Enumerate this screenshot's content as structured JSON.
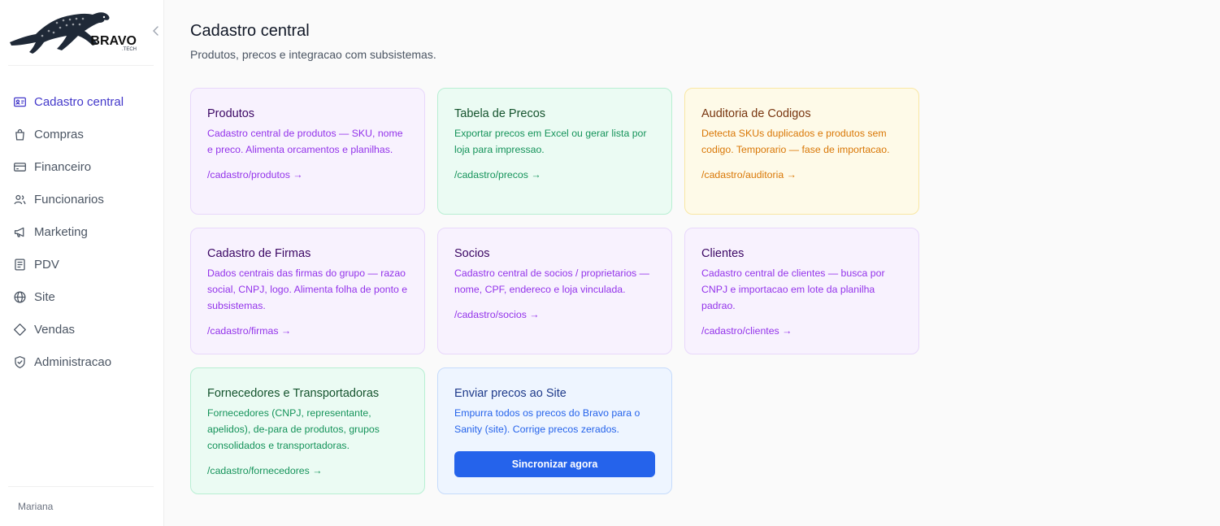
{
  "brand": {
    "name": "BRAVO",
    "suffix": ".TECH"
  },
  "sidebar": {
    "collapse_icon": "chevron-left-icon",
    "items": [
      {
        "label": "Cadastro central",
        "icon": "id-card-icon",
        "active": true
      },
      {
        "label": "Compras",
        "icon": "shopping-bag-icon"
      },
      {
        "label": "Financeiro",
        "icon": "credit-card-icon"
      },
      {
        "label": "Funcionarios",
        "icon": "users-icon"
      },
      {
        "label": "Marketing",
        "icon": "megaphone-icon"
      },
      {
        "label": "PDV",
        "icon": "receipt-icon"
      },
      {
        "label": "Site",
        "icon": "globe-icon"
      },
      {
        "label": "Vendas",
        "icon": "tag-icon"
      },
      {
        "label": "Administracao",
        "icon": "shield-icon"
      }
    ],
    "user": "Mariana"
  },
  "header": {
    "title": "Cadastro central",
    "subtitle": "Produtos, precos e integracao com subsistemas."
  },
  "cards": [
    {
      "title": "Produtos",
      "description": "Cadastro central de produtos — SKU, nome e preco. Alimenta orcamentos e planilhas.",
      "link": "/cadastro/produtos →",
      "color": "purple"
    },
    {
      "title": "Tabela de Precos",
      "description": "Exportar precos em Excel ou gerar lista por loja para impressao.",
      "link": "/cadastro/precos →",
      "color": "green"
    },
    {
      "title": "Auditoria de Codigos",
      "description": "Detecta SKUs duplicados e produtos sem codigo. Temporario — fase de importacao.",
      "link": "/cadastro/auditoria →",
      "color": "yellow"
    },
    {
      "title": "Cadastro de Firmas",
      "description": "Dados centrais das firmas do grupo — razao social, CNPJ, logo. Alimenta folha de ponto e subsistemas.",
      "link": "/cadastro/firmas →",
      "color": "purple"
    },
    {
      "title": "Socios",
      "description": "Cadastro central de socios / proprietarios — nome, CPF, endereco e loja vinculada.",
      "link": "/cadastro/socios →",
      "color": "purple"
    },
    {
      "title": "Clientes",
      "description": "Cadastro central de clientes — busca por CNPJ e importacao em lote da planilha padrao.",
      "link": "/cadastro/clientes →",
      "color": "purple"
    },
    {
      "title": "Fornecedores e Transportadoras",
      "description": "Fornecedores (CNPJ, representante, apelidos), de-para de produtos, grupos consolidados e transportadoras.",
      "link": "/cadastro/fornecedores →",
      "color": "green"
    },
    {
      "title": "Enviar precos ao Site",
      "description": "Empurra todos os precos do Bravo para o Sanity (site). Corrige precos zerados.",
      "button": "Sincronizar agora",
      "color": "blue"
    }
  ],
  "colors": {
    "accent": "#4338ca",
    "button": "#2563eb",
    "purple": "#9333ea",
    "green": "#15935a",
    "yellow": "#d97706",
    "blue": "#2563eb"
  }
}
